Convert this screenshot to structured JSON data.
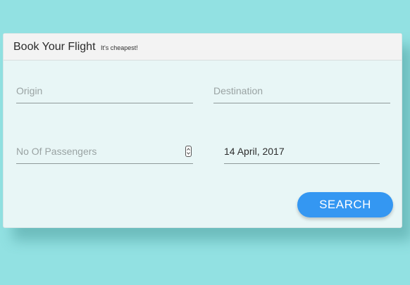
{
  "header": {
    "title": "Book Your Flight",
    "subtitle": "It's cheapest!"
  },
  "form": {
    "origin_placeholder": "Origin",
    "destination_placeholder": "Destination",
    "passengers_placeholder": "No Of Passengers",
    "date_value": "14 April, 2017"
  },
  "actions": {
    "search_label": "SEARCH"
  },
  "colors": {
    "background": "#92e1e2",
    "card": "#e8f6f6",
    "header": "#f3f3f3",
    "button": "#3497f2"
  }
}
